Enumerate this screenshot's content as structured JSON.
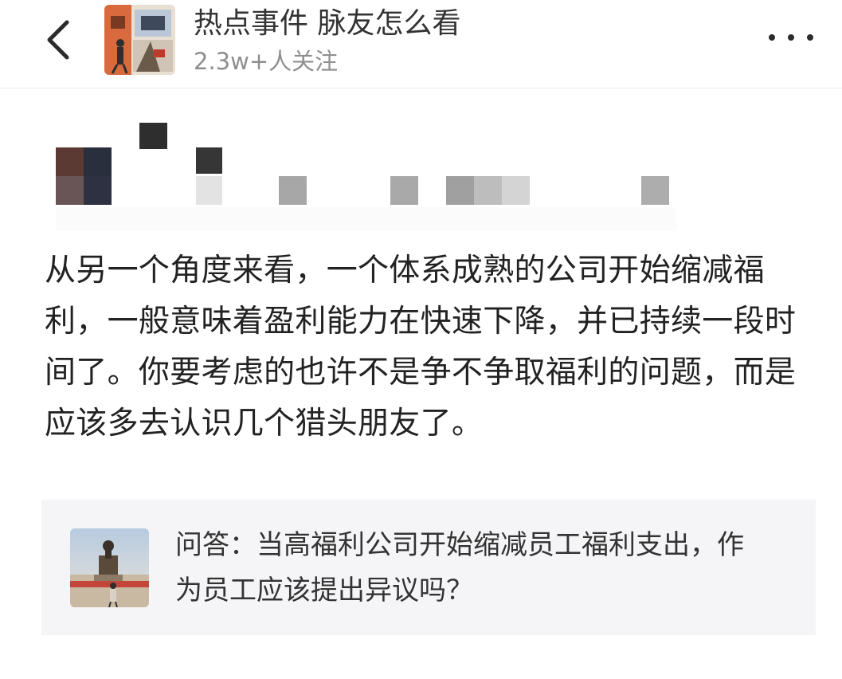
{
  "header": {
    "back_icon": "chevron-left-icon",
    "topic_title": "热点事件 脉友怎么看",
    "topic_followers": "2.3w+人关注",
    "more_icon": "more-horizontal-icon"
  },
  "post": {
    "body": "从另一个角度来看，一个体系成熟的公司开始缩减福利，一般意味着盈利能力在快速下降，并已持续一段时间了。你要考虑的也许不是争不争取福利的问题，而是应该多去认识几个猎头朋友了。"
  },
  "linked_question": {
    "text": "问答：当高福利公司开始缩减员工福利支出，作为员工应该提出异议吗？"
  },
  "colors": {
    "text_primary": "#222222",
    "text_secondary": "#8e8e8e",
    "card_background": "#f5f5f7"
  }
}
